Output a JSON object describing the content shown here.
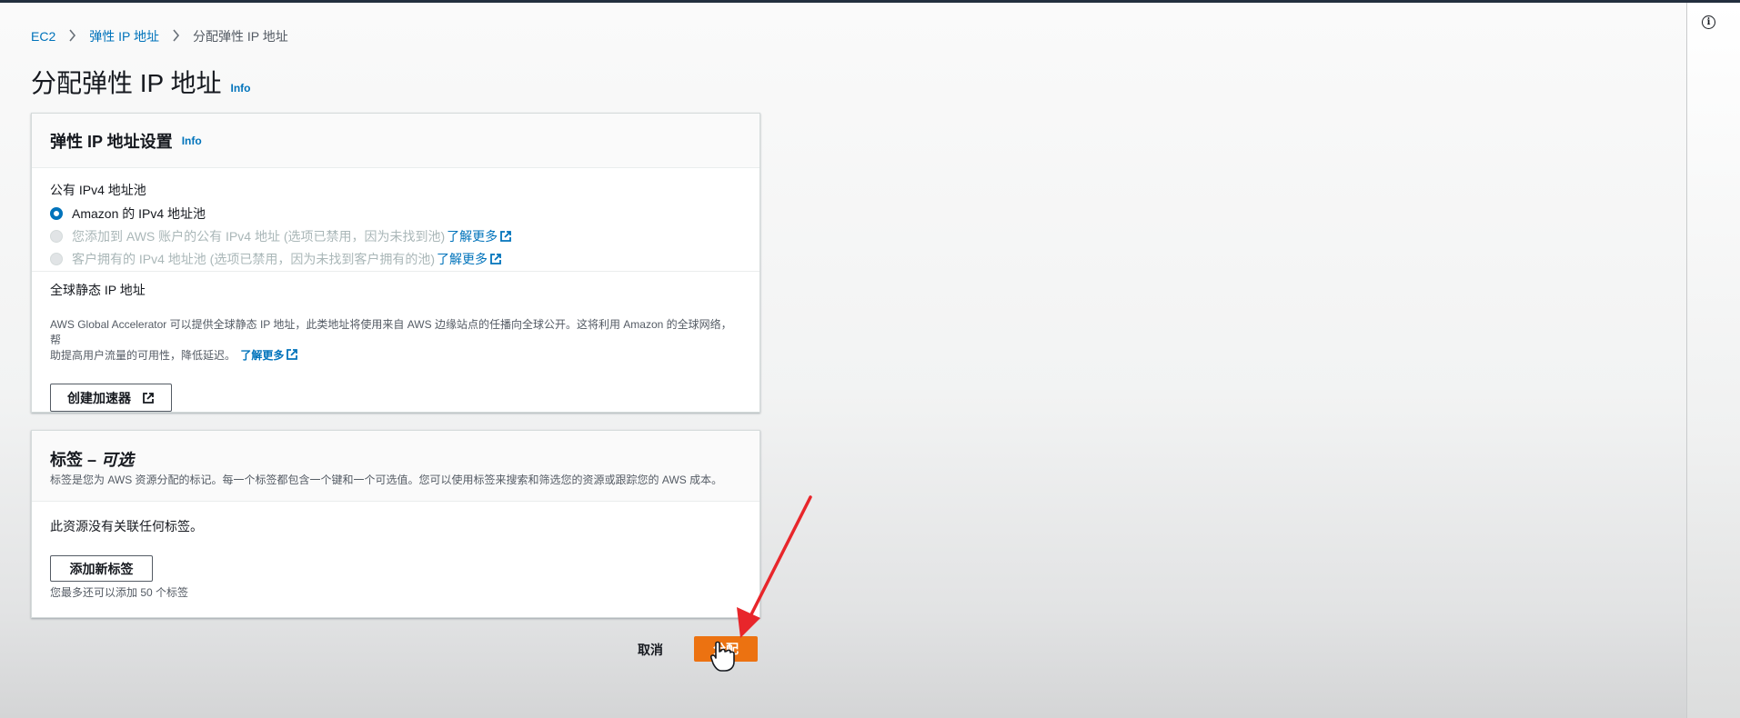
{
  "breadcrumb": {
    "items": [
      "EC2",
      "弹性 IP 地址"
    ],
    "current": "分配弹性 IP 地址"
  },
  "page": {
    "title": "分配弹性 IP 地址",
    "info": "Info"
  },
  "settings_panel": {
    "title": "弹性 IP 地址设置",
    "info": "Info",
    "pool_label": "公有 IPv4 地址池",
    "options": [
      {
        "label": "Amazon 的 IPv4 地址池",
        "selected": true,
        "disabled": false
      },
      {
        "label": "您添加到 AWS 账户的公有 IPv4 地址 (选项已禁用，因为未找到池)",
        "link": "了解更多",
        "selected": false,
        "disabled": true
      },
      {
        "label": "客户拥有的 IPv4 地址池 (选项已禁用，因为未找到客户拥有的池)",
        "link": "了解更多",
        "selected": false,
        "disabled": true
      }
    ],
    "global_label": "全球静态 IP 地址",
    "global_desc_line1": "AWS Global Accelerator 可以提供全球静态 IP 地址，此类地址将使用来自 AWS 边缘站点的任播向全球公开。这将利用 Amazon 的全球网络，帮",
    "global_desc_line2": "助提高用户流量的可用性，降低延迟。",
    "global_desc_link": "了解更多",
    "create_accelerator_button": "创建加速器"
  },
  "tags_panel": {
    "title": "标签 – ",
    "title_optional": "可选",
    "description": "标签是您为 AWS 资源分配的标记。每一个标签都包含一个键和一个可选值。您可以使用标签来搜索和筛选您的资源或跟踪您的 AWS 成本。",
    "empty_text": "此资源没有关联任何标签。",
    "add_button": "添加新标签",
    "limit_text": "您最多还可以添加 50 个标签"
  },
  "actions": {
    "cancel": "取消",
    "allocate": "分配"
  },
  "colors": {
    "accent_blue": "#0073bb",
    "primary_orange": "#ec7211",
    "annotation_red": "#e8262b",
    "topbar": "#232f3e"
  },
  "icons": [
    "chevron-right-icon",
    "info-circle-icon",
    "external-link-icon",
    "hand-cursor-icon",
    "red-arrow-annotation"
  ]
}
